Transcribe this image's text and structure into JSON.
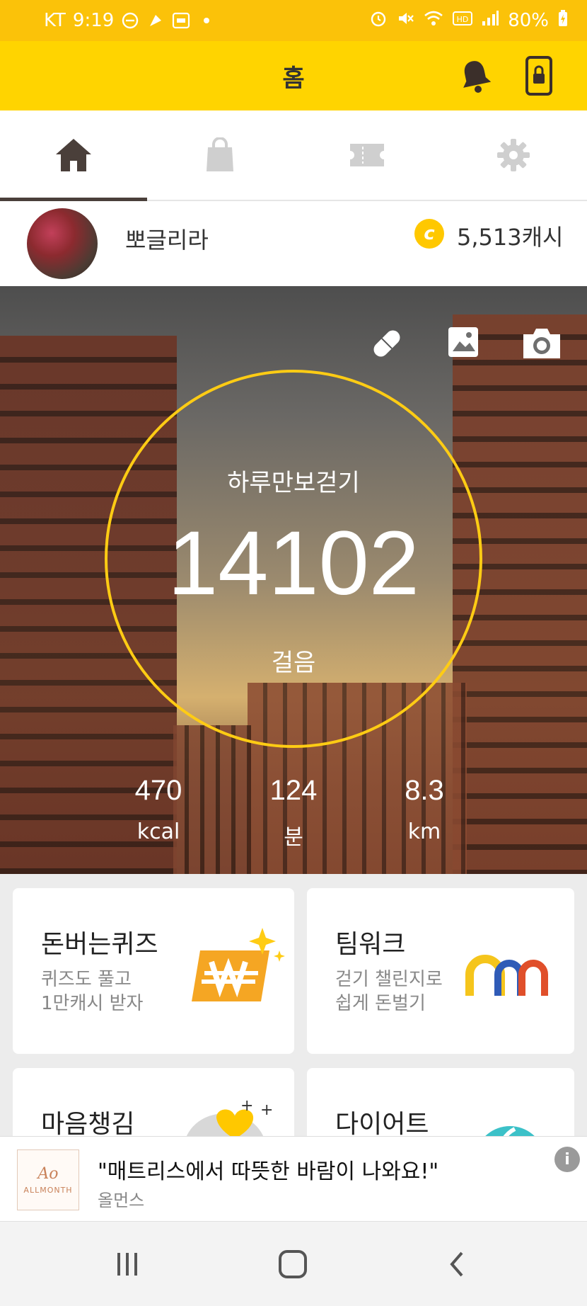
{
  "status_bar": {
    "carrier": "KT",
    "time": "9:19",
    "battery": "80%"
  },
  "header": {
    "title": "홈",
    "accent_color": "#FFD400",
    "bell_icon": "bell-icon",
    "lock_icon": "phone-lock-icon"
  },
  "tabs": [
    {
      "icon": "home-icon",
      "active": true
    },
    {
      "icon": "shopping-bag-icon",
      "active": false
    },
    {
      "icon": "ticket-icon",
      "active": false
    },
    {
      "icon": "gear-icon",
      "active": false
    }
  ],
  "profile": {
    "username": "뽀글리라",
    "coin_icon_letter": "c",
    "cash": "5,513캐시"
  },
  "hero": {
    "goal_label": "하루만보걷기",
    "steps": "14102",
    "steps_unit": "걸음",
    "ring_color": "#FFCC14",
    "stats": [
      {
        "value": "470",
        "unit": "kcal"
      },
      {
        "value": "124",
        "unit": "분"
      },
      {
        "value": "8.3",
        "unit": "km"
      }
    ]
  },
  "cards": [
    {
      "title": "돈버는퀴즈",
      "sub1": "퀴즈도 풀고",
      "sub2": "1만캐시 받자"
    },
    {
      "title": "팀워크",
      "sub1": "걷기 챌린지로",
      "sub2": "쉽게 돈벌기"
    },
    {
      "title": "마음챙김"
    },
    {
      "title": "다이어트"
    }
  ],
  "ad": {
    "logo_script": "Ao",
    "logo_text": "ALLMONTH",
    "title": "\"매트리스에서 따뜻한 바람이 나와요!\"",
    "advertiser": "올먼스",
    "info": "i"
  }
}
